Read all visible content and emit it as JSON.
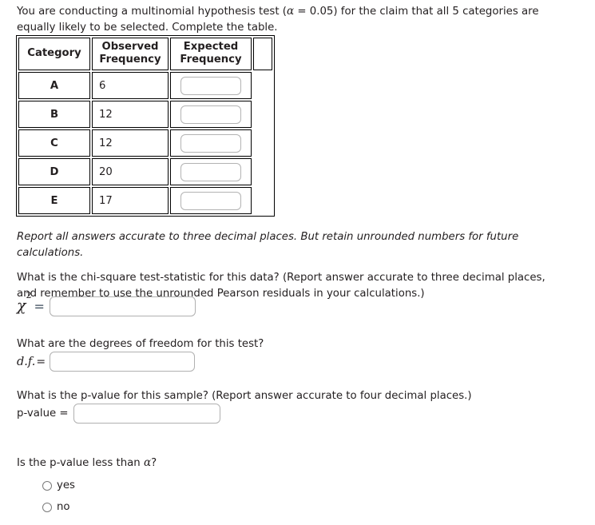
{
  "intro": {
    "before_alpha": "You are conducting a multinomial hypothesis test (",
    "alpha_symbol": "α",
    "after_alpha": " = 0.05) for the claim that all 5 categories are equally likely to be selected. Complete the table."
  },
  "table": {
    "headers": [
      "Category",
      "Observed Frequency",
      "Expected Frequency",
      ""
    ],
    "header_lines": {
      "category": "Category",
      "observed_line1": "Observed",
      "observed_line2": "Frequency",
      "expected_line1": "Expected",
      "expected_line2": "Frequency"
    },
    "rows": [
      {
        "category": "A",
        "observed": "6",
        "expected": ""
      },
      {
        "category": "B",
        "observed": "12",
        "expected": ""
      },
      {
        "category": "C",
        "observed": "12",
        "expected": ""
      },
      {
        "category": "D",
        "observed": "20",
        "expected": ""
      },
      {
        "category": "E",
        "observed": "17",
        "expected": ""
      }
    ]
  },
  "note": "Report all answers accurate to three decimal places. But retain unrounded numbers for future calculations.",
  "questions": {
    "chi_square": {
      "prompt": "What is the chi-square test-statistic for this data? (Report answer accurate to three decimal places, and remember to use the unrounded Pearson residuals in your calculations.)",
      "symbol": "χ",
      "exponent": "2",
      "equals": "=",
      "value": ""
    },
    "degrees_of_freedom": {
      "prompt": "What are the degrees of freedom for this test?",
      "label": "d.f.",
      "equals": "=",
      "value": ""
    },
    "p_value": {
      "prompt": "What is the p-value for this sample? (Report answer accurate to four decimal places.)",
      "label": "p-value =",
      "value": ""
    },
    "comparison": {
      "prompt_before_alpha": "Is the p-value less than ",
      "alpha_symbol": "α",
      "prompt_after_alpha": "?",
      "options": [
        {
          "label": "yes",
          "selected": false
        },
        {
          "label": "no",
          "selected": false
        }
      ]
    }
  },
  "colors": {
    "text": "#231f20",
    "table_border": "#000000",
    "input_border": "#b3b3b3"
  }
}
